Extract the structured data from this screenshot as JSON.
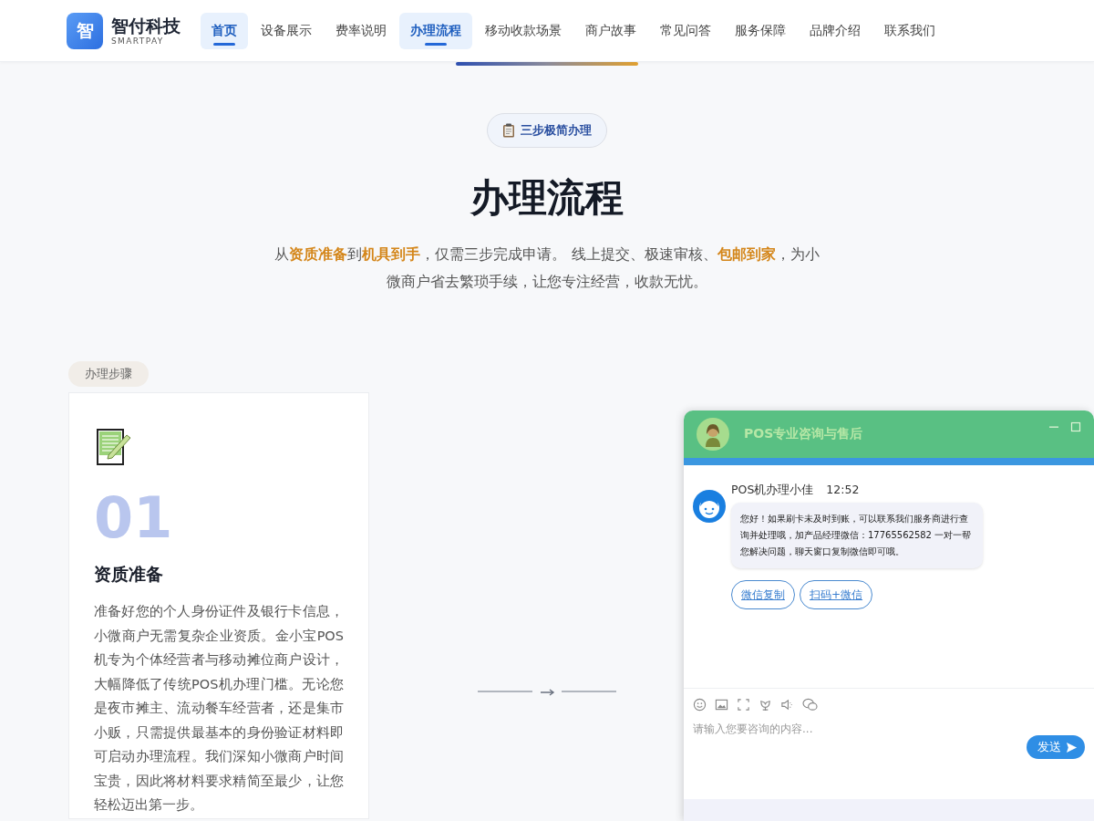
{
  "brand": {
    "logo_char": "智",
    "name": "智付科技",
    "tagline": "SMARTPAY"
  },
  "nav": [
    {
      "label": "首页",
      "selected": true
    },
    {
      "label": "设备展示",
      "selected": false
    },
    {
      "label": "费率说明",
      "selected": false
    },
    {
      "label": "办理流程",
      "selected": true
    },
    {
      "label": "移动收款场景",
      "selected": false
    },
    {
      "label": "商户故事",
      "selected": false
    },
    {
      "label": "常见问答",
      "selected": false
    },
    {
      "label": "服务保障",
      "selected": false
    },
    {
      "label": "品牌介绍",
      "selected": false
    },
    {
      "label": "联系我们",
      "selected": false
    }
  ],
  "hero": {
    "badge": "三步极简办理",
    "title": "办理流程",
    "description": "从**资质准备**到**机具到手**，仅需三步完成申请。 线上提交、极速审核、**包邮到家**，为小微商户省去繁琐手续，让您专注经营，收款无忧。"
  },
  "steps_label": "办理步骤",
  "steps": [
    {
      "number": "01",
      "title": "资质准备",
      "text": "准备好您的个人身份证件及银行卡信息，小微商户无需复杂企业资质。金小宝POS机专为个体经营者与移动摊位商户设计，大幅降低了传统POS机办理门槛。无论您是夜市摊主、流动餐车经营者，还是集市小贩，只需提供最基本的身份验证材料即可启动办理流程。我们深知小微商户时间宝贵，因此将材料要求精简至最少，让您轻松迈出第一步。"
    }
  ],
  "chat": {
    "title": "POS专业咨询与售后",
    "messages": [
      {
        "sender": "POS机办理小佳",
        "time": "12:52",
        "text": "您好！如果刷卡未及时到账，可以联系我们服务商进行查询并处理哦，加产品经理微信：17765562582 一对一帮您解决问题，聊天窗口复制微信即可哦。"
      }
    ],
    "actions": [
      "微信复制",
      "扫码+微信"
    ],
    "input": {
      "placeholder": "请输入您要咨询的内容..."
    },
    "send_label": "发送"
  }
}
